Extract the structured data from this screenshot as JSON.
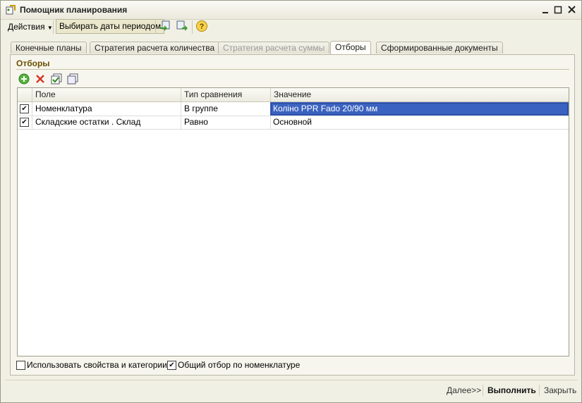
{
  "window": {
    "title": "Помощник планирования"
  },
  "toolbar": {
    "actions": "Действия",
    "period": "Выбирать даты периодом"
  },
  "tabs": [
    {
      "label": "Конечные планы",
      "state": "normal"
    },
    {
      "label": "Стратегия расчета количества",
      "state": "normal"
    },
    {
      "label": "Стратегия расчета суммы",
      "state": "disabled"
    },
    {
      "label": "Отборы",
      "state": "active"
    },
    {
      "label": "Сформированные документы",
      "state": "normal"
    }
  ],
  "filters": {
    "group_title": "Отборы",
    "columns": {
      "field": "Поле",
      "compare": "Тип сравнения",
      "value": "Значение"
    },
    "rows": [
      {
        "checked": true,
        "field": "Номенклатура",
        "compare": "В группе",
        "value": "Коліно PPR Fado 20/90 мм"
      },
      {
        "checked": true,
        "field": "Складские остатки . Склад",
        "compare": "Равно",
        "value": "Основной"
      }
    ]
  },
  "options": {
    "use_props": {
      "label": "Использовать свойства и категории",
      "checked": false
    },
    "common_filter": {
      "label": "Общий отбор по номенклатуре",
      "checked": true
    }
  },
  "footer": {
    "next": "Далее>>",
    "run": "Выполнить",
    "close": "Закрыть"
  },
  "colors": {
    "accent_title": "#6b4f00",
    "selection": "#3a62c0"
  }
}
